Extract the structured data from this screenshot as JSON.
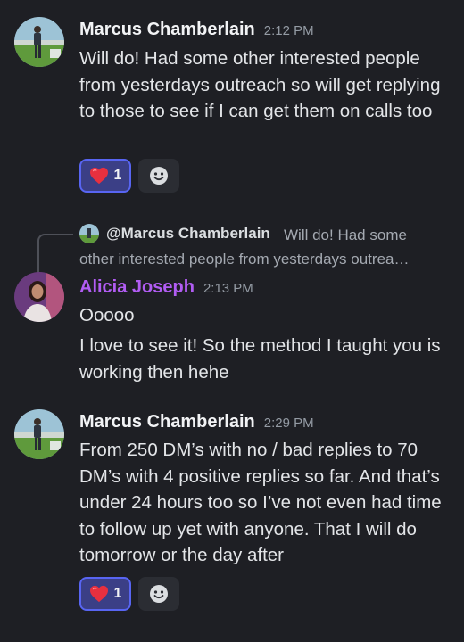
{
  "messages": [
    {
      "author": "Marcus Chamberlain",
      "time": "2:12 PM",
      "text": "Will do! Had some other interested people from yesterdays outreach so will get replying to those to see if I can get them on calls too",
      "reaction": {
        "emoji": "heart",
        "count": "1"
      }
    },
    {
      "reply": {
        "author": "@Marcus Chamberlain",
        "preview_first": "Will do! Had some",
        "preview_second": "other interested people from yesterdays outrea…"
      },
      "author": "Alicia Joseph",
      "time": "2:13 PM",
      "lines": [
        "Ooooo",
        "I love to see it! So the method I taught you is working then hehe"
      ]
    },
    {
      "author": "Marcus Chamberlain",
      "time": "2:29 PM",
      "text": "From 250 DM’s with no / bad replies to 70 DM’s with 4 positive replies so far. And that’s under 24 hours too so I’ve not even had time to follow up yet with anyone. That I will do tomorrow or the day after",
      "reaction": {
        "emoji": "heart",
        "count": "1"
      }
    }
  ],
  "colors": {
    "background": "#1e1f24",
    "alicia_name": "#b15cf3",
    "reaction_border": "#5865f2"
  }
}
